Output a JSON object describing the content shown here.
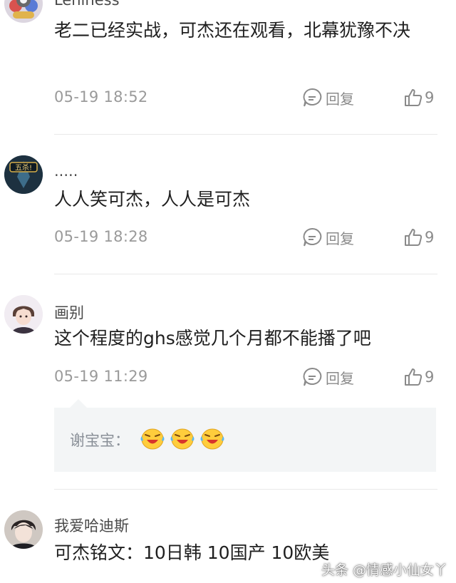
{
  "comments": [
    {
      "username": "Leniness",
      "text": "老二已经实战，可杰还在观看，北幕犹豫不决",
      "time": "05-19 18:52",
      "reply_label": "回复",
      "likes": "9"
    },
    {
      "username": ".....",
      "avatar_badge": "五杀!",
      "text": "人人笑可杰，人人是可杰",
      "time": "05-19 18:28",
      "reply_label": "回复",
      "likes": "9"
    },
    {
      "username": "画别",
      "text": "这个程度的ghs感觉几个月都不能播了吧",
      "time": "05-19 11:29",
      "reply_label": "回复",
      "likes": "9",
      "sub_reply": {
        "author": "谢宝宝：",
        "emoji_icons": [
          "laughing-crying-emoji",
          "laughing-crying-emoji",
          "laughing-crying-emoji"
        ]
      }
    },
    {
      "username": "我爱哈迪斯",
      "text": "可杰铭文：10日韩 10国产 10欧美"
    }
  ],
  "watermark": "头条 @情感小仙女丫",
  "colors": {
    "username": "#4a4a4a",
    "text": "#1f1f1f",
    "meta": "#9a9a9a",
    "subreply_bg": "#f3f5f6"
  }
}
